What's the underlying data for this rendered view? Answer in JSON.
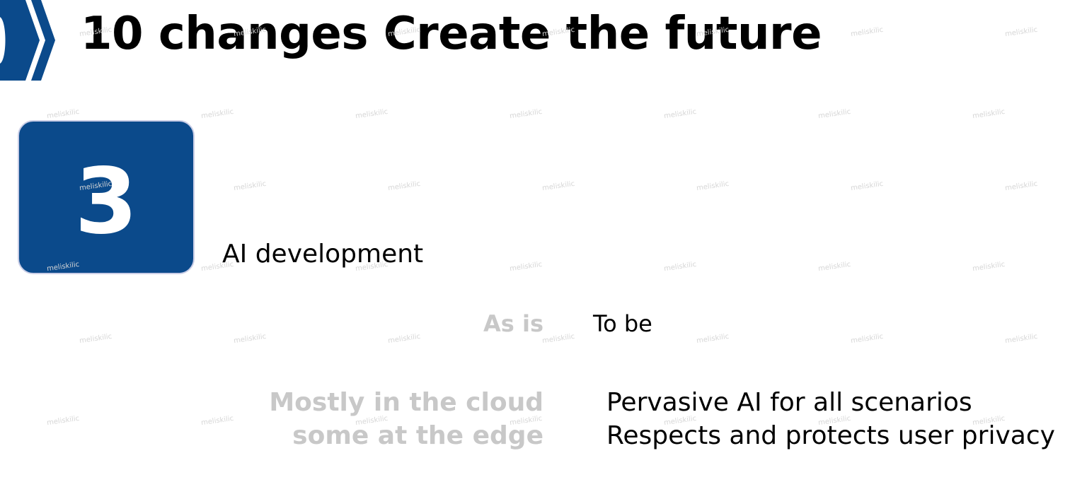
{
  "header": {
    "title": "10 changes Create the future"
  },
  "badge": {
    "number": "3"
  },
  "section": {
    "heading": "AI development"
  },
  "comparison": {
    "as_is_label": "As is",
    "to_be_label": "To be",
    "as_is_lines": [
      "Mostly in the cloud",
      "some at the edge"
    ],
    "to_be_lines": [
      "Pervasive AI for all scenarios",
      "Respects and protects user privacy"
    ]
  },
  "watermark": {
    "text": "meliskilic"
  },
  "colors": {
    "brand_blue": "#0b4a8b",
    "muted_text": "#c8c8c8",
    "text": "#000000"
  },
  "icons": {
    "header_logo": "chevron-arrow-icon"
  }
}
